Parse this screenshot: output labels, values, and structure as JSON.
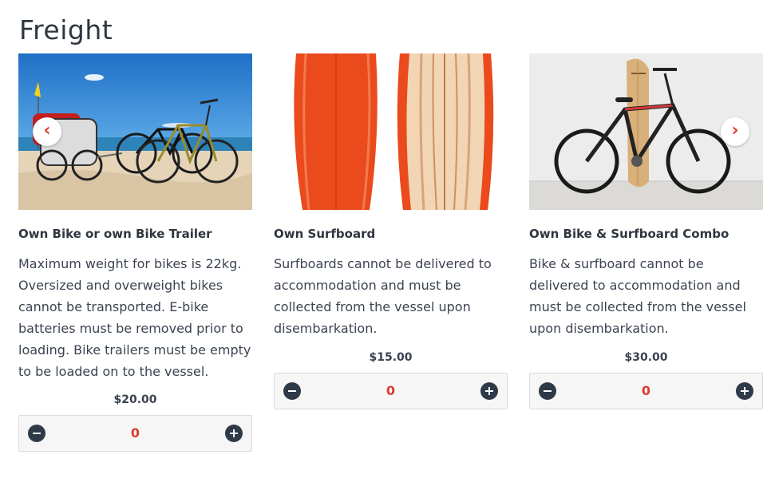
{
  "page": {
    "title": "Freight"
  },
  "products": [
    {
      "title": "Own Bike or own Bike Trailer",
      "description": "Maximum weight for bikes is 22kg. Oversized and overweight bikes cannot be transported. E-bike batteries must be removed prior to loading. Bike trailers must be empty to be loaded on to the vessel.",
      "price": "$20.00",
      "quantity": "0",
      "image_icon": "bike-trailer-beach-image"
    },
    {
      "title": "Own Surfboard",
      "description": "Surfboards cannot be delivered to accommodation and must be collected from the vessel upon disembarkation.",
      "price": "$15.00",
      "quantity": "0",
      "image_icon": "surfboard-image"
    },
    {
      "title": "Own Bike & Surfboard Combo",
      "description": "Bike & surfboard cannot be delivered to accommodation and must be collected from the vessel upon disembarkation.",
      "price": "$30.00",
      "quantity": "0",
      "image_icon": "bike-surfboard-image"
    }
  ],
  "carousel": {
    "prev_icon": "chevron-left-icon",
    "next_icon": "chevron-right-icon",
    "prev_label": "‹",
    "next_label": "›"
  },
  "colors": {
    "accent": "#e03a2f",
    "button": "#2f3a48",
    "text": "#3b4350"
  }
}
